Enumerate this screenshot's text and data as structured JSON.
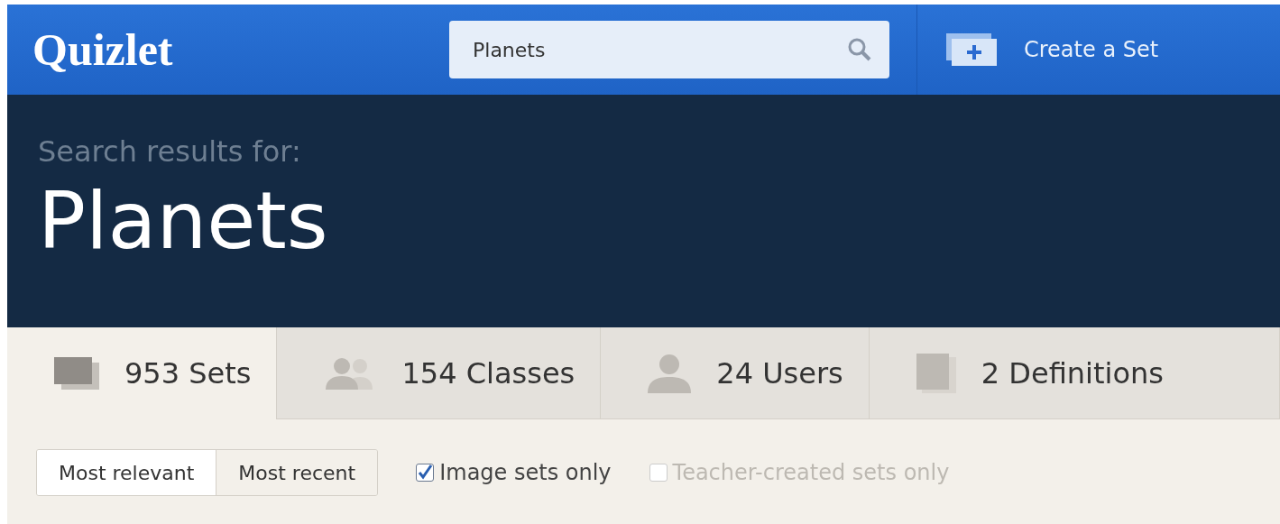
{
  "header": {
    "logo": "Quizlet",
    "search": {
      "value": "Planets"
    },
    "create_button": "Create a Set"
  },
  "hero": {
    "subtitle": "Search results for:",
    "title": "Planets"
  },
  "tabs": [
    {
      "kind": "sets",
      "label": "953 Sets",
      "selected": true
    },
    {
      "kind": "classes",
      "label": "154 Classes",
      "selected": false
    },
    {
      "kind": "users",
      "label": "24 Users",
      "selected": false
    },
    {
      "kind": "definitions",
      "label": "2 Definitions",
      "selected": false
    }
  ],
  "sort_options": [
    {
      "label": "Most relevant",
      "selected": true
    },
    {
      "label": "Most recent",
      "selected": false
    }
  ],
  "filters": [
    {
      "label": "Image sets only",
      "checked": true,
      "disabled": false
    },
    {
      "label": "Teacher-created sets only",
      "checked": false,
      "disabled": true
    }
  ]
}
